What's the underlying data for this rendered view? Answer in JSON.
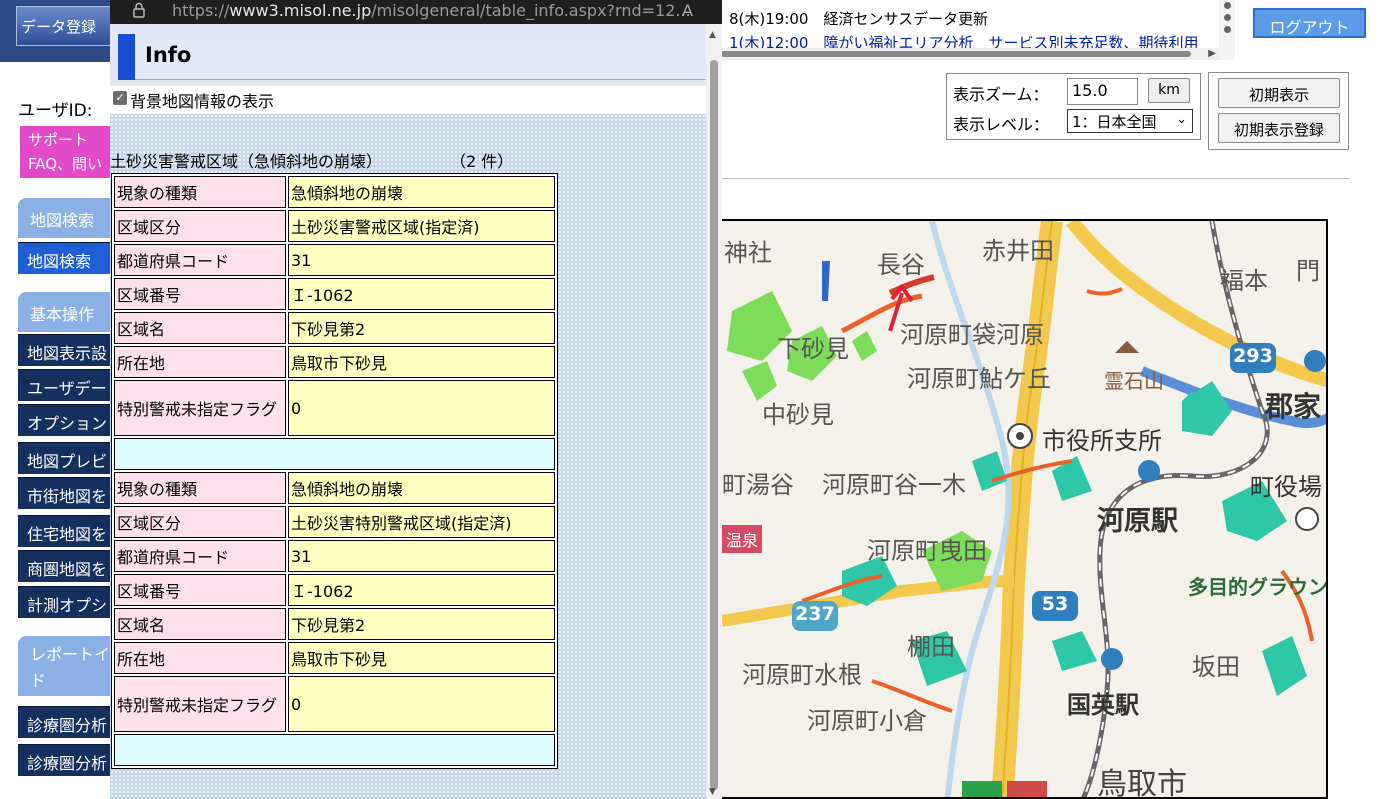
{
  "sidebar": {
    "data_register": "データ登録",
    "user_id_label": "ユーザID:",
    "support": [
      "サポート",
      "FAQ、問い"
    ],
    "sections": [
      {
        "label": "地図検索"
      },
      {
        "label": "基本操作"
      },
      {
        "label": "レポートイ",
        "label2": "ド"
      }
    ],
    "items": [
      {
        "label": "地図検索"
      },
      {
        "label": "地図表示設"
      },
      {
        "label": "ユーザデー"
      },
      {
        "label": "オプション"
      },
      {
        "label": "地図プレビ"
      },
      {
        "label": "市街地図を"
      },
      {
        "label": "住宅地図を"
      },
      {
        "label": "商圏地図を"
      },
      {
        "label": "計測オプシ"
      },
      {
        "label": "診療圏分析"
      },
      {
        "label": "診療圏分析"
      }
    ]
  },
  "news": [
    {
      "text": "8(木)19:00　経済センサスデータ更新"
    },
    {
      "text": "1(木)12:00　障がい福祉エリア分析　サービス別未充足数、期待利用"
    }
  ],
  "header": {
    "logout": "ログアウト",
    "zoom_label": "表示ズーム：",
    "zoom_value": "15.0",
    "zoom_unit": "km",
    "level_label": "表示レベル：",
    "level_value": "1：日本全国",
    "initial_view": "初期表示",
    "initial_view_register": "初期表示登録"
  },
  "popup": {
    "url_prefix": "https://",
    "url_host": "www3.misol.ne.jp",
    "url_path": "/misolgeneral/table_info.aspx?rnd=12...",
    "reader_icon": "A",
    "title": "Info",
    "bg_map_checkbox_label": "背景地図情報の表示",
    "table_caption": "土砂災害警戒区域（急傾斜地の崩壊）",
    "table_count": "（2 件）",
    "records": [
      {
        "rows": [
          {
            "key": "現象の種類",
            "value": "急傾斜地の崩壊"
          },
          {
            "key": "区域区分",
            "value": "土砂災害警戒区域(指定済)"
          },
          {
            "key": "都道府県コード",
            "value": "31"
          },
          {
            "key": "区域番号",
            "value": "Ｉ-1062"
          },
          {
            "key": "区域名",
            "value": "下砂見第2"
          },
          {
            "key": "所在地",
            "value": "鳥取市下砂見"
          },
          {
            "key": "特別警戒未指定フラグ",
            "value": "0"
          }
        ]
      },
      {
        "rows": [
          {
            "key": "現象の種類",
            "value": "急傾斜地の崩壊"
          },
          {
            "key": "区域区分",
            "value": "土砂災害特別警戒区域(指定済)"
          },
          {
            "key": "都道府県コード",
            "value": "31"
          },
          {
            "key": "区域番号",
            "value": "Ｉ-1062"
          },
          {
            "key": "区域名",
            "value": "下砂見第2"
          },
          {
            "key": "所在地",
            "value": "鳥取市下砂見"
          },
          {
            "key": "特別警戒未指定フラグ",
            "value": "0"
          }
        ]
      }
    ]
  },
  "map": {
    "places": [
      {
        "name": "神社"
      },
      {
        "name": "長谷"
      },
      {
        "name": "赤井田"
      },
      {
        "name": "福本"
      },
      {
        "name": "門"
      },
      {
        "name": "河原町袋河原"
      },
      {
        "name": "下砂見"
      },
      {
        "name": "河原町鮎ケ丘"
      },
      {
        "name": "霊石山"
      },
      {
        "name": "郡家"
      },
      {
        "name": "中砂見"
      },
      {
        "name": "市役所支所"
      },
      {
        "name": "町湯谷"
      },
      {
        "name": "河原町谷一木"
      },
      {
        "name": "町役場"
      },
      {
        "name": "河原駅"
      },
      {
        "name": "温泉"
      },
      {
        "name": "河原町曳田"
      },
      {
        "name": "多目的グラウン"
      },
      {
        "name": "棚田"
      },
      {
        "name": "坂田"
      },
      {
        "name": "河原町水根"
      },
      {
        "name": "国英駅"
      },
      {
        "name": "河原町小倉"
      },
      {
        "name": "鳥取市"
      }
    ],
    "routes": [
      "293",
      "237",
      "53"
    ],
    "colors": {
      "sediment_orange": "#e8622a",
      "cliff_red": "#d23a2a",
      "teal": "#2ec8a8",
      "green": "#7ddc5a",
      "arrow": "#e0203c"
    }
  }
}
